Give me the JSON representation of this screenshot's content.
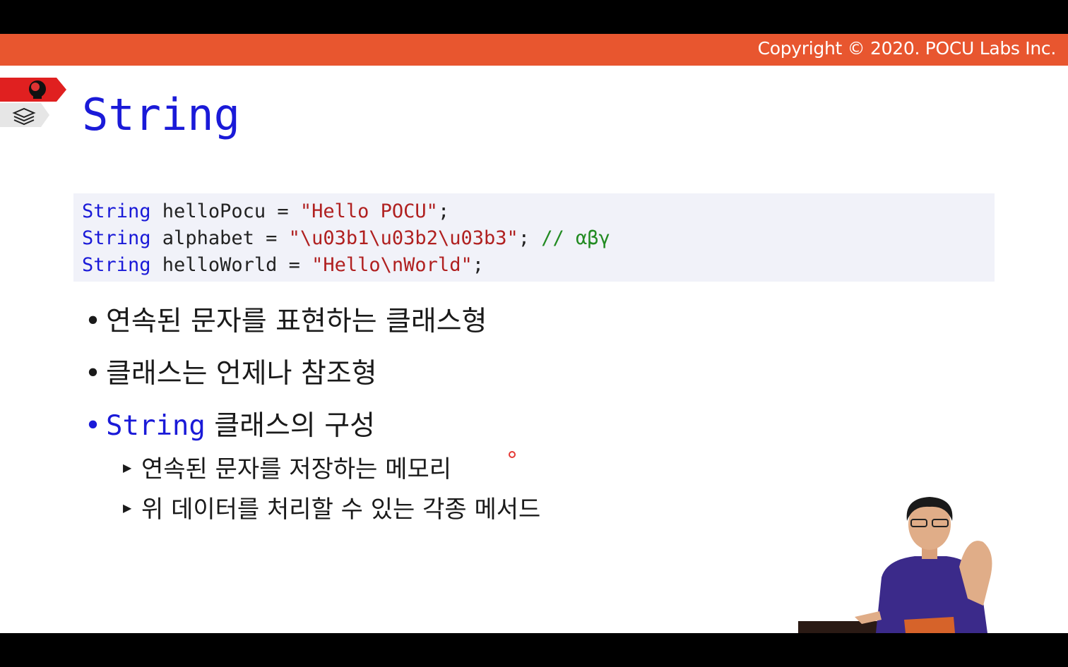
{
  "header": {
    "copyright": "Copyright © 2020. POCU Labs Inc."
  },
  "nav_icons": [
    "brain-icon",
    "book-stack-icon"
  ],
  "slide": {
    "title": "String",
    "code": [
      {
        "type": "String",
        "name": " helloPocu = ",
        "value": "\"Hello POCU\"",
        "end": ";",
        "comment": ""
      },
      {
        "type": "String",
        "name": " alphabet = ",
        "value": "\"\\u03b1\\u03b2\\u03b3\"",
        "end": "; ",
        "comment": "// αβγ"
      },
      {
        "type": "String",
        "name": " helloWorld = ",
        "value": "\"Hello\\nWorld\"",
        "end": ";",
        "comment": ""
      }
    ],
    "bullets": [
      "연속된 문자를 표현하는 클래스형",
      "클래스는 언제나 참조형"
    ],
    "bullet3": {
      "keyword": "String",
      "text": " 클래스의 구성"
    },
    "sub_bullets": [
      "연속된 문자를 저장하는 메모리",
      "위 데이터를 처리할 수 있는 각종 메서드"
    ]
  },
  "colors": {
    "header_band": "#e8562f",
    "keyword_blue": "#1a1ad8",
    "string_red": "#b02020",
    "comment_green": "#228b22",
    "code_bg": "#f1f2f9"
  }
}
